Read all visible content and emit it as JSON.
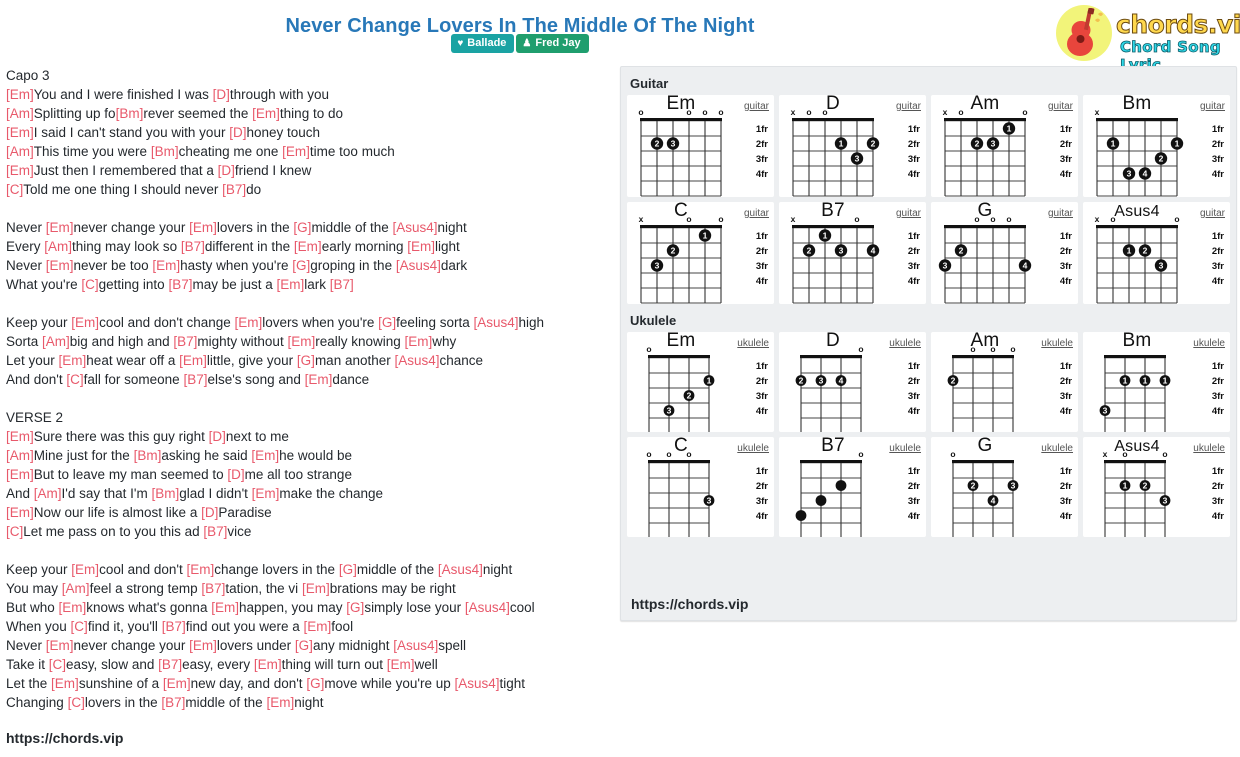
{
  "header": {
    "title": "Never Change Lovers In The Middle Of The Night",
    "badges": [
      {
        "label": "Ballade",
        "icon": "music-heart-icon",
        "color": "#1aa3a3"
      },
      {
        "label": "Fred Jay",
        "icon": "person-icon",
        "color": "#1f9e6e"
      }
    ]
  },
  "logo": {
    "icon": "guitar-icon",
    "text_primary": "chords.vip",
    "text_secondary": "Chord Song Lyric",
    "circle_color": "#f2f47a",
    "primary_color": "#ffd84d",
    "secondary_color": "#2fd8e8"
  },
  "lyrics": {
    "chord_color": "#e8596b",
    "lines": [
      "Capo 3",
      "[Em]You and I were finished I was [D]through with you",
      "[Am]Splitting up fo[Bm]rever seemed the [Em]thing to do",
      "[Em]I said I can't stand you with your [D]honey touch",
      "[Am]This time you were [Bm]cheating me one [Em]time too much",
      "[Em]Just then I remembered that a [D]friend I knew",
      "[C]Told me one thing I should never [B7]do",
      "",
      "Never [Em]never change your [Em]lovers in the [G]middle of the [Asus4]night",
      "Every [Am]thing may look so [B7]different in the [Em]early morning [Em]light",
      "Never [Em]never be too [Em]hasty when you're [G]groping in the [Asus4]dark",
      "What you're [C]getting into [B7]may be just a [Em]lark [B7]",
      "",
      "Keep your [Em]cool and don't change [Em]lovers when you're [G]feeling sorta [Asus4]high",
      "Sorta [Am]big and high and [B7]mighty without [Em]really knowing [Em]why",
      "Let your [Em]heat wear off a [Em]little, give your [G]man another [Asus4]chance",
      "And don't [C]fall for someone [B7]else's song and [Em]dance",
      "",
      "VERSE 2",
      "[Em]Sure there was this guy right [D]next to me",
      "[Am]Mine just for the [Bm]asking he said [Em]he would be",
      "[Em]But to leave my man seemed to [D]me all too strange",
      "And [Am]I'd say that I'm [Bm]glad I didn't [Em]make the change",
      "[Em]Now our life is almost like a [D]Paradise",
      "[C]Let me pass on to you this ad [B7]vice",
      "",
      "Keep your [Em]cool and don't [Em]change lovers in the [G]middle of the [Asus4]night",
      "You may [Am]feel a strong temp [B7]tation, the vi [Em]brations may be right",
      "But who [Em]knows what's gonna [Em]happen, you may [G]simply lose your [Asus4]cool",
      "When you [C]find it, you'll [B7]find out you were a [Em]fool",
      "Never [Em]never change your [Em]lovers under [G]any midnight [Asus4]spell",
      "Take it [C]easy, slow and [B7]easy, every [Em]thing will turn out [Em]well",
      "Let the [Em]sunshine of a [Em]new day, and don't [G]move while you're up [Asus4]tight",
      "Changing [C]lovers in the [B7]middle of the [Em]night"
    ]
  },
  "footer": {
    "url": "https://chords.vip"
  },
  "panel": {
    "url": "https://chords.vip",
    "sections": [
      {
        "heading": "Guitar",
        "instrument_label": "guitar",
        "strings": 6,
        "fret_labels": [
          "1fr",
          "2fr",
          "3fr",
          "4fr"
        ],
        "chords": [
          {
            "name": "Em",
            "markers": [
              "o",
              "",
              "",
              "o",
              "o",
              "o"
            ],
            "dots": [
              {
                "string": 2,
                "fret": 2,
                "finger": "2"
              },
              {
                "string": 3,
                "fret": 2,
                "finger": "3"
              }
            ]
          },
          {
            "name": "D",
            "markers": [
              "x",
              "o",
              "o",
              "",
              "",
              ""
            ],
            "dots": [
              {
                "string": 4,
                "fret": 2,
                "finger": "1"
              },
              {
                "string": 6,
                "fret": 2,
                "finger": "2"
              },
              {
                "string": 5,
                "fret": 3,
                "finger": "3"
              }
            ]
          },
          {
            "name": "Am",
            "markers": [
              "x",
              "o",
              "",
              "",
              "",
              "o"
            ],
            "dots": [
              {
                "string": 5,
                "fret": 1,
                "finger": "1"
              },
              {
                "string": 3,
                "fret": 2,
                "finger": "2"
              },
              {
                "string": 4,
                "fret": 2,
                "finger": "3"
              }
            ]
          },
          {
            "name": "Bm",
            "markers": [
              "x",
              "",
              "",
              "",
              "",
              ""
            ],
            "dots": [
              {
                "string": 2,
                "fret": 2,
                "finger": "1"
              },
              {
                "string": 6,
                "fret": 2,
                "finger": "1"
              },
              {
                "string": 5,
                "fret": 3,
                "finger": "2"
              },
              {
                "string": 3,
                "fret": 4,
                "finger": "3"
              },
              {
                "string": 4,
                "fret": 4,
                "finger": "4"
              }
            ]
          },
          {
            "name": "C",
            "markers": [
              "x",
              "",
              "",
              "o",
              "",
              "o"
            ],
            "dots": [
              {
                "string": 5,
                "fret": 1,
                "finger": "1"
              },
              {
                "string": 3,
                "fret": 2,
                "finger": "2"
              },
              {
                "string": 2,
                "fret": 3,
                "finger": "3"
              }
            ]
          },
          {
            "name": "B7",
            "markers": [
              "x",
              "",
              "",
              "",
              "o",
              ""
            ],
            "dots": [
              {
                "string": 3,
                "fret": 1,
                "finger": "1"
              },
              {
                "string": 2,
                "fret": 2,
                "finger": "2"
              },
              {
                "string": 4,
                "fret": 2,
                "finger": "3"
              },
              {
                "string": 6,
                "fret": 2,
                "finger": "4"
              }
            ]
          },
          {
            "name": "G",
            "markers": [
              "",
              "",
              "o",
              "o",
              "o",
              ""
            ],
            "dots": [
              {
                "string": 2,
                "fret": 2,
                "finger": "2"
              },
              {
                "string": 1,
                "fret": 3,
                "finger": "3"
              },
              {
                "string": 6,
                "fret": 3,
                "finger": "4"
              }
            ]
          },
          {
            "name": "Asus4",
            "markers": [
              "x",
              "o",
              "",
              "",
              "",
              "o"
            ],
            "dots": [
              {
                "string": 3,
                "fret": 2,
                "finger": "1"
              },
              {
                "string": 4,
                "fret": 2,
                "finger": "2"
              },
              {
                "string": 5,
                "fret": 3,
                "finger": "3"
              }
            ]
          }
        ]
      },
      {
        "heading": "Ukulele",
        "instrument_label": "ukulele",
        "strings": 4,
        "fret_labels": [
          "1fr",
          "2fr",
          "3fr",
          "4fr"
        ],
        "chords": [
          {
            "name": "Em",
            "markers": [
              "o",
              "",
              "",
              ""
            ],
            "dots": [
              {
                "string": 4,
                "fret": 2,
                "finger": "1"
              },
              {
                "string": 3,
                "fret": 3,
                "finger": "2"
              },
              {
                "string": 2,
                "fret": 4,
                "finger": "3"
              }
            ]
          },
          {
            "name": "D",
            "markers": [
              "",
              "",
              "",
              "o"
            ],
            "dots": [
              {
                "string": 1,
                "fret": 2,
                "finger": "2"
              },
              {
                "string": 2,
                "fret": 2,
                "finger": "3"
              },
              {
                "string": 3,
                "fret": 2,
                "finger": "4"
              }
            ]
          },
          {
            "name": "Am",
            "markers": [
              "",
              "o",
              "o",
              "o"
            ],
            "dots": [
              {
                "string": 1,
                "fret": 2,
                "finger": "2"
              }
            ]
          },
          {
            "name": "Bm",
            "markers": [
              "",
              "",
              "",
              ""
            ],
            "dots": [
              {
                "string": 2,
                "fret": 2,
                "finger": "1"
              },
              {
                "string": 3,
                "fret": 2,
                "finger": "1"
              },
              {
                "string": 4,
                "fret": 2,
                "finger": "1"
              },
              {
                "string": 1,
                "fret": 4,
                "finger": "3"
              }
            ]
          },
          {
            "name": "C",
            "markers": [
              "o",
              "o",
              "o",
              ""
            ],
            "dots": [
              {
                "string": 4,
                "fret": 3,
                "finger": "3"
              }
            ]
          },
          {
            "name": "B7",
            "markers": [
              "",
              "",
              "",
              "o"
            ],
            "dots": [
              {
                "string": 3,
                "fret": 2,
                "finger": ""
              },
              {
                "string": 2,
                "fret": 3,
                "finger": ""
              },
              {
                "string": 1,
                "fret": 4,
                "finger": ""
              }
            ]
          },
          {
            "name": "G",
            "markers": [
              "o",
              "",
              "",
              ""
            ],
            "dots": [
              {
                "string": 2,
                "fret": 2,
                "finger": "2"
              },
              {
                "string": 4,
                "fret": 2,
                "finger": "3"
              },
              {
                "string": 3,
                "fret": 3,
                "finger": "4"
              }
            ]
          },
          {
            "name": "Asus4",
            "markers": [
              "x",
              "o",
              "",
              "o"
            ],
            "dots": [
              {
                "string": 2,
                "fret": 2,
                "finger": "1"
              },
              {
                "string": 3,
                "fret": 2,
                "finger": "2"
              },
              {
                "string": 4,
                "fret": 3,
                "finger": "3"
              }
            ]
          }
        ]
      }
    ]
  }
}
